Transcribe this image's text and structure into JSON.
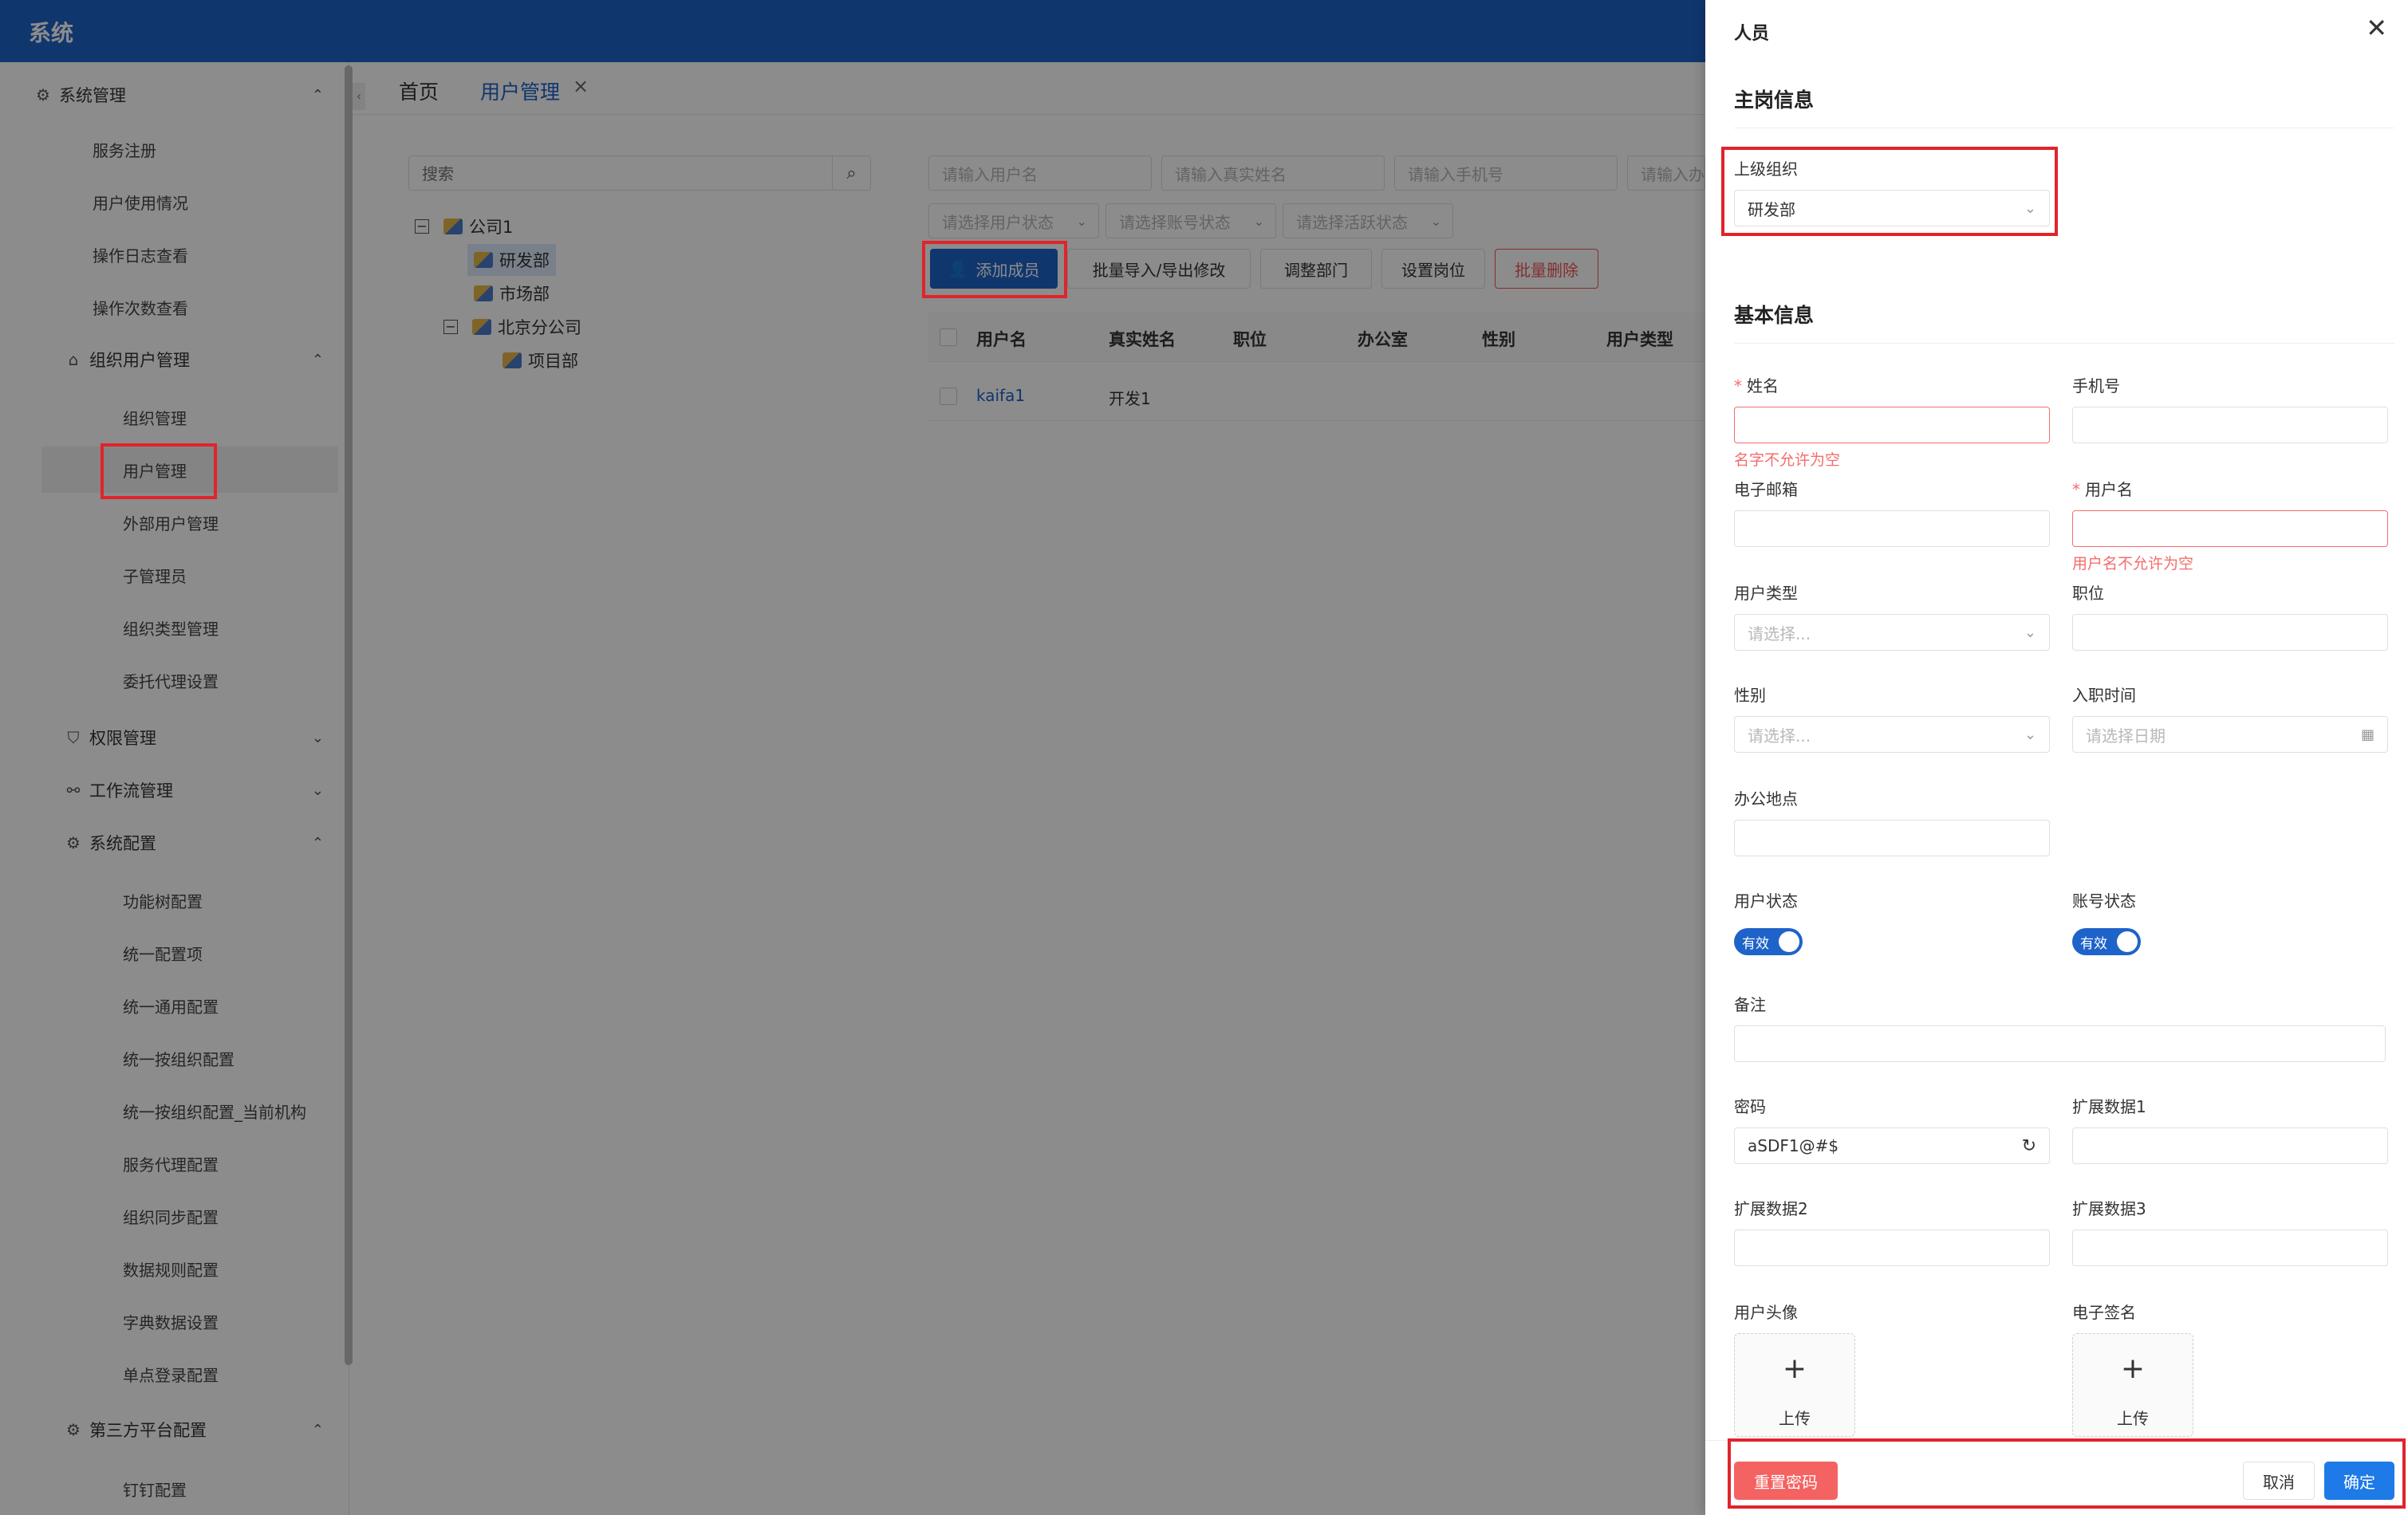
{
  "app": {
    "title": "系统"
  },
  "sidebar": {
    "groups": {
      "system_mgmt": "系统管理",
      "org_user_mgmt": "组织用户管理",
      "permission_mgmt": "权限管理",
      "workflow_mgmt": "工作流管理",
      "system_config": "系统配置",
      "third_party": "第三方平台配置"
    },
    "system_items": [
      "服务注册",
      "用户使用情况",
      "操作日志查看",
      "操作次数查看"
    ],
    "org_items": [
      "组织管理",
      "用户管理",
      "外部用户管理",
      "子管理员",
      "组织类型管理",
      "委托代理设置"
    ],
    "config_items": [
      "功能树配置",
      "统一配置项",
      "统一通用配置",
      "统一按组织配置",
      "统一按组织配置_当前机构",
      "服务代理配置",
      "组织同步配置",
      "数据规则配置",
      "字典数据设置",
      "单点登录配置"
    ],
    "third_items": [
      "钉钉配置"
    ]
  },
  "tabs": {
    "home": "首页",
    "user_mgmt": "用户管理"
  },
  "tree": {
    "search_placeholder": "搜索",
    "nodes": [
      "公司1",
      "研发部",
      "市场部",
      "北京分公司",
      "项目部"
    ]
  },
  "filters": {
    "username": "请输入用户名",
    "realname": "请输入真实姓名",
    "phone": "请输入手机号",
    "office": "请输入办",
    "user_status": "请选择用户状态",
    "account_status": "请选择账号状态",
    "active_status": "请选择活跃状态"
  },
  "toolbar": {
    "add_member": "添加成员",
    "batch_import": "批量导入/导出修改",
    "adjust_dept": "调整部门",
    "set_post": "设置岗位",
    "batch_delete": "批量删除"
  },
  "table": {
    "headers": [
      "用户名",
      "真实姓名",
      "职位",
      "办公室",
      "性别",
      "用户类型"
    ],
    "rows": [
      {
        "username": "kaifa1",
        "realname": "开发1"
      }
    ]
  },
  "drawer": {
    "title": "人员",
    "main_post_section": "主岗信息",
    "parent_org_label": "上级组织",
    "parent_org_value": "研发部",
    "basic_section": "基本信息",
    "fields": {
      "name": "姓名",
      "name_error": "名字不允许为空",
      "phone": "手机号",
      "email": "电子邮箱",
      "username": "用户名",
      "username_error": "用户名不允许为空",
      "user_type": "用户类型",
      "user_type_placeholder": "请选择...",
      "position": "职位",
      "gender": "性别",
      "gender_placeholder": "请选择...",
      "join_date": "入职时间",
      "join_date_placeholder": "请选择日期",
      "office_location": "办公地点",
      "user_status": "用户状态",
      "user_status_value": "有效",
      "account_status": "账号状态",
      "account_status_value": "有效",
      "remark": "备注",
      "password": "密码",
      "password_value": "aSDF1@#$",
      "ext1": "扩展数据1",
      "ext2": "扩展数据2",
      "ext3": "扩展数据3",
      "avatar": "用户头像",
      "signature": "电子签名",
      "upload": "上传"
    },
    "footer": {
      "reset_password": "重置密码",
      "cancel": "取消",
      "confirm": "确定"
    }
  },
  "colors": {
    "primary": "#1e63c9",
    "danger": "#f56262",
    "highlight": "#e0242c"
  }
}
